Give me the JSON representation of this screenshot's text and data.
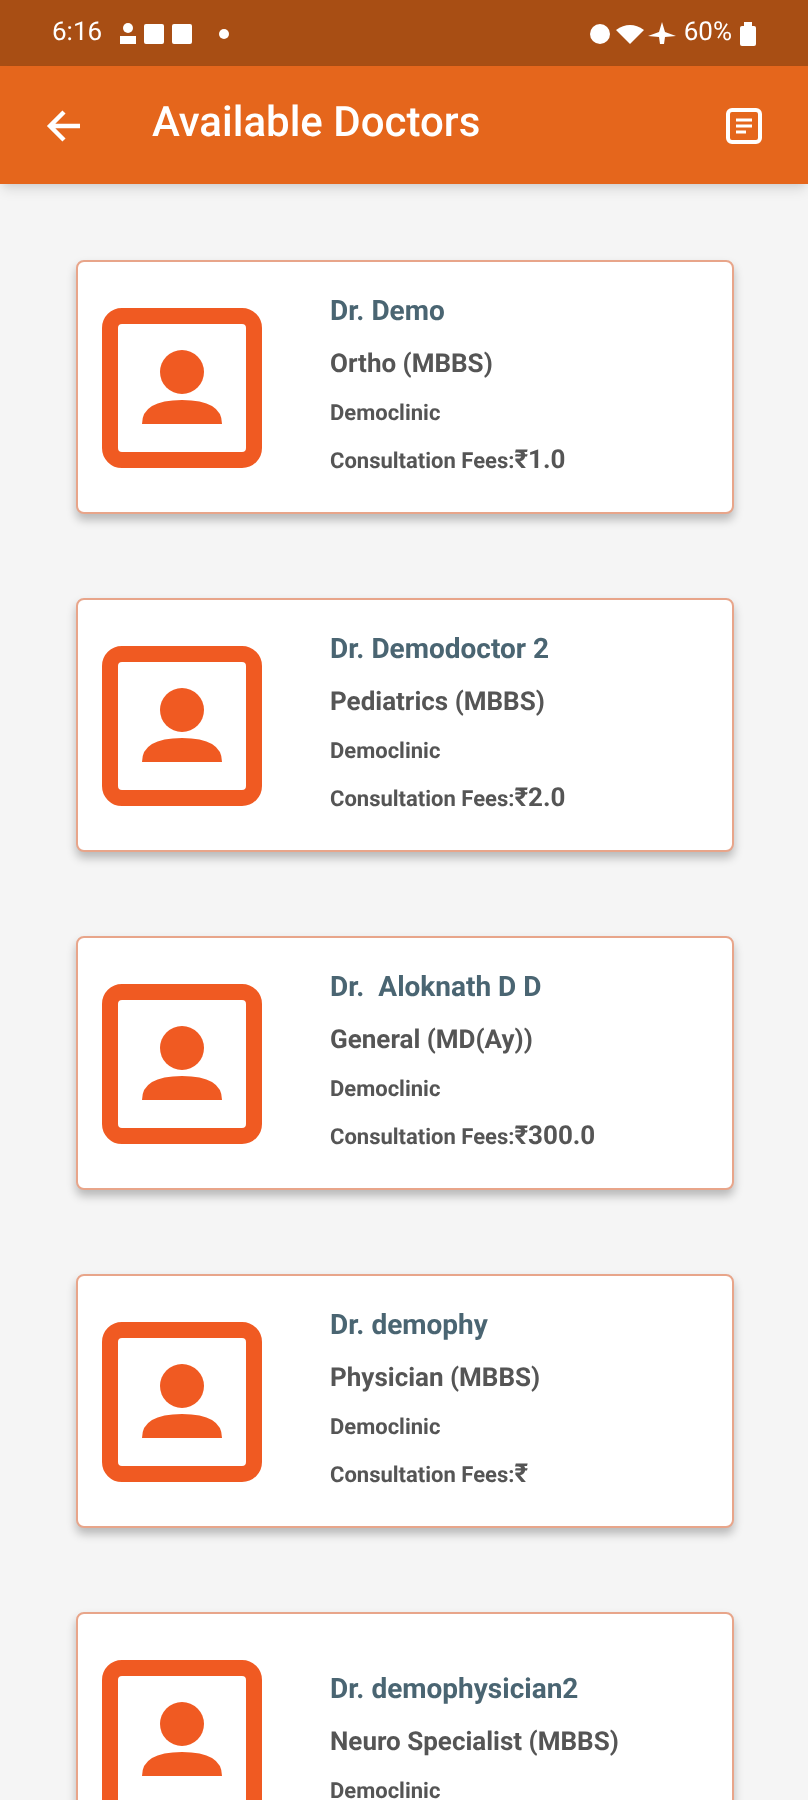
{
  "status_bar": {
    "time": "6:16",
    "battery": "60%"
  },
  "app_bar": {
    "title": "Available Doctors"
  },
  "doctors": [
    {
      "name": "Dr. Demo",
      "specialty": "Ortho (MBBS)",
      "clinic": "Democlinic",
      "fees_label": "Consultation Fees:",
      "fees": "₹1.0"
    },
    {
      "name": "Dr. Demodoctor 2",
      "specialty": "Pediatrics (MBBS)",
      "clinic": "Democlinic",
      "fees_label": "Consultation Fees:",
      "fees": "₹2.0"
    },
    {
      "name": "Dr.  Aloknath D D",
      "specialty": "General (MD(Ay))",
      "clinic": "Democlinic",
      "fees_label": "Consultation Fees:",
      "fees": "₹300.0"
    },
    {
      "name": "Dr. demophy",
      "specialty": "Physician (MBBS)",
      "clinic": "Democlinic",
      "fees_label": "Consultation Fees:",
      "fees": "₹"
    },
    {
      "name": "Dr. demophysician2",
      "specialty": "Neuro Specialist (MBBS)",
      "clinic": "Democlinic"
    }
  ]
}
